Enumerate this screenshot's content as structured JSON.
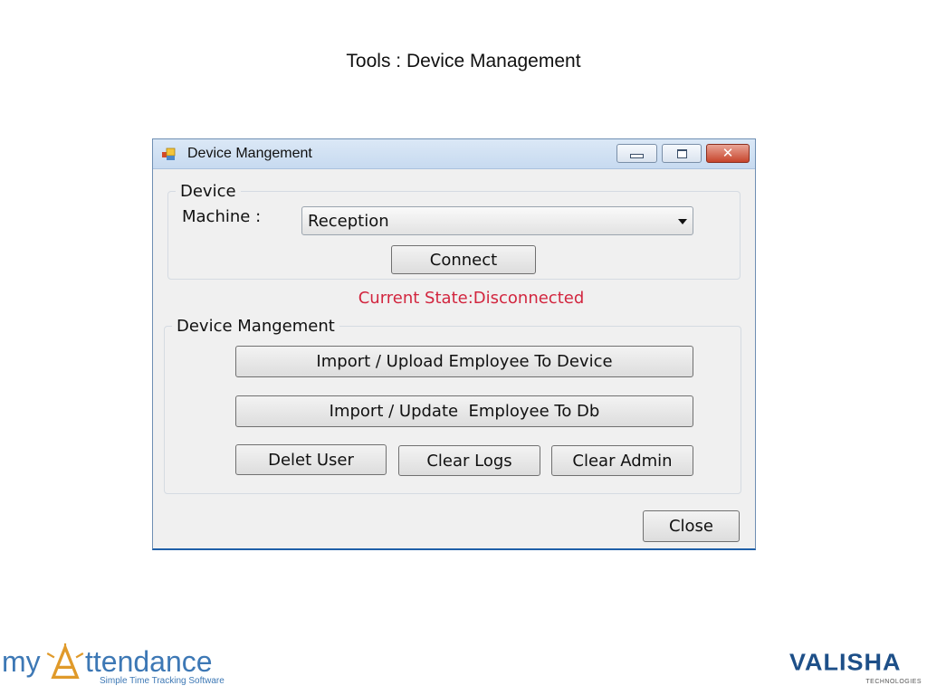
{
  "slide": {
    "title": "Tools : Device Management"
  },
  "window": {
    "title": "Device Mangement",
    "icon": "app-window-icon",
    "controls": {
      "minimize": "minimize-icon",
      "maximize": "maximize-icon",
      "close": "close-icon"
    }
  },
  "device_group": {
    "legend": "Device",
    "machine_label": "Machine :",
    "machine_value": "Reception",
    "connect_label": "Connect"
  },
  "status": {
    "text": "Current State:Disconnected",
    "color": "#d2263f"
  },
  "management_group": {
    "legend": "Device Mangement",
    "upload_label": "Import / Upload Employee To Device",
    "update_label": "Import / Update  Employee To Db",
    "delete_label": "Delet User",
    "clear_logs_label": "Clear Logs",
    "clear_admin_label": "Clear Admin"
  },
  "footer": {
    "close_label": "Close"
  },
  "logos": {
    "left": {
      "name": "myAttendance",
      "prefix": "my",
      "suffix": "ttendance",
      "tagline": "Simple Time Tracking Software"
    },
    "right": {
      "name": "VALISHA",
      "word": "VALISHA",
      "tagline": "TECHNOLOGIES"
    }
  }
}
